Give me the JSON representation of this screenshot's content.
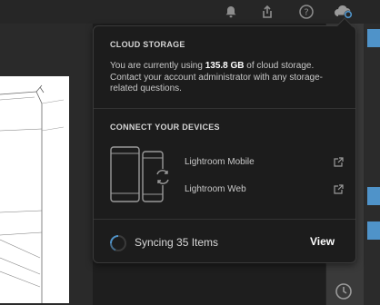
{
  "toolbar": {
    "icons": [
      "bell-icon",
      "share-icon",
      "help-icon",
      "cloud-icon"
    ]
  },
  "cloud_storage": {
    "title": "CLOUD STORAGE",
    "text_before": "You are currently using ",
    "amount": "135.8 GB",
    "text_after": " of cloud storage. Contact your account administrator with any storage-related questions."
  },
  "devices": {
    "title": "CONNECT YOUR DEVICES",
    "items": [
      {
        "label": "Lightroom Mobile",
        "icon": "external-link-icon"
      },
      {
        "label": "Lightroom Web",
        "icon": "external-link-icon"
      }
    ]
  },
  "sync": {
    "label": "Syncing 35 Items",
    "view_label": "View"
  },
  "colors": {
    "accent": "#4f93c9",
    "popover_bg": "#1c1c1c"
  }
}
